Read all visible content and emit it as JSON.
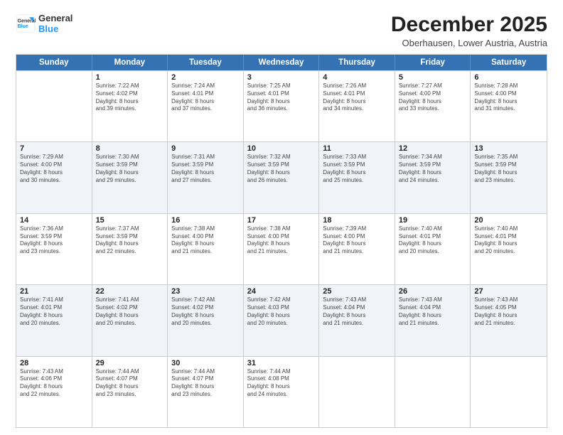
{
  "logo": {
    "line1": "General",
    "line2": "Blue"
  },
  "header": {
    "title": "December 2025",
    "subtitle": "Oberhausen, Lower Austria, Austria"
  },
  "days": [
    "Sunday",
    "Monday",
    "Tuesday",
    "Wednesday",
    "Thursday",
    "Friday",
    "Saturday"
  ],
  "weeks": [
    {
      "shade": "normal",
      "cells": [
        {
          "day": "",
          "lines": []
        },
        {
          "day": "1",
          "lines": [
            "Sunrise: 7:22 AM",
            "Sunset: 4:02 PM",
            "Daylight: 8 hours",
            "and 39 minutes."
          ]
        },
        {
          "day": "2",
          "lines": [
            "Sunrise: 7:24 AM",
            "Sunset: 4:01 PM",
            "Daylight: 8 hours",
            "and 37 minutes."
          ]
        },
        {
          "day": "3",
          "lines": [
            "Sunrise: 7:25 AM",
            "Sunset: 4:01 PM",
            "Daylight: 8 hours",
            "and 36 minutes."
          ]
        },
        {
          "day": "4",
          "lines": [
            "Sunrise: 7:26 AM",
            "Sunset: 4:01 PM",
            "Daylight: 8 hours",
            "and 34 minutes."
          ]
        },
        {
          "day": "5",
          "lines": [
            "Sunrise: 7:27 AM",
            "Sunset: 4:00 PM",
            "Daylight: 8 hours",
            "and 33 minutes."
          ]
        },
        {
          "day": "6",
          "lines": [
            "Sunrise: 7:28 AM",
            "Sunset: 4:00 PM",
            "Daylight: 8 hours",
            "and 31 minutes."
          ]
        }
      ]
    },
    {
      "shade": "alt",
      "cells": [
        {
          "day": "7",
          "lines": [
            "Sunrise: 7:29 AM",
            "Sunset: 4:00 PM",
            "Daylight: 8 hours",
            "and 30 minutes."
          ]
        },
        {
          "day": "8",
          "lines": [
            "Sunrise: 7:30 AM",
            "Sunset: 3:59 PM",
            "Daylight: 8 hours",
            "and 29 minutes."
          ]
        },
        {
          "day": "9",
          "lines": [
            "Sunrise: 7:31 AM",
            "Sunset: 3:59 PM",
            "Daylight: 8 hours",
            "and 27 minutes."
          ]
        },
        {
          "day": "10",
          "lines": [
            "Sunrise: 7:32 AM",
            "Sunset: 3:59 PM",
            "Daylight: 8 hours",
            "and 26 minutes."
          ]
        },
        {
          "day": "11",
          "lines": [
            "Sunrise: 7:33 AM",
            "Sunset: 3:59 PM",
            "Daylight: 8 hours",
            "and 25 minutes."
          ]
        },
        {
          "day": "12",
          "lines": [
            "Sunrise: 7:34 AM",
            "Sunset: 3:59 PM",
            "Daylight: 8 hours",
            "and 24 minutes."
          ]
        },
        {
          "day": "13",
          "lines": [
            "Sunrise: 7:35 AM",
            "Sunset: 3:59 PM",
            "Daylight: 8 hours",
            "and 23 minutes."
          ]
        }
      ]
    },
    {
      "shade": "normal",
      "cells": [
        {
          "day": "14",
          "lines": [
            "Sunrise: 7:36 AM",
            "Sunset: 3:59 PM",
            "Daylight: 8 hours",
            "and 23 minutes."
          ]
        },
        {
          "day": "15",
          "lines": [
            "Sunrise: 7:37 AM",
            "Sunset: 3:59 PM",
            "Daylight: 8 hours",
            "and 22 minutes."
          ]
        },
        {
          "day": "16",
          "lines": [
            "Sunrise: 7:38 AM",
            "Sunset: 4:00 PM",
            "Daylight: 8 hours",
            "and 21 minutes."
          ]
        },
        {
          "day": "17",
          "lines": [
            "Sunrise: 7:38 AM",
            "Sunset: 4:00 PM",
            "Daylight: 8 hours",
            "and 21 minutes."
          ]
        },
        {
          "day": "18",
          "lines": [
            "Sunrise: 7:39 AM",
            "Sunset: 4:00 PM",
            "Daylight: 8 hours",
            "and 21 minutes."
          ]
        },
        {
          "day": "19",
          "lines": [
            "Sunrise: 7:40 AM",
            "Sunset: 4:01 PM",
            "Daylight: 8 hours",
            "and 20 minutes."
          ]
        },
        {
          "day": "20",
          "lines": [
            "Sunrise: 7:40 AM",
            "Sunset: 4:01 PM",
            "Daylight: 8 hours",
            "and 20 minutes."
          ]
        }
      ]
    },
    {
      "shade": "alt",
      "cells": [
        {
          "day": "21",
          "lines": [
            "Sunrise: 7:41 AM",
            "Sunset: 4:01 PM",
            "Daylight: 8 hours",
            "and 20 minutes."
          ]
        },
        {
          "day": "22",
          "lines": [
            "Sunrise: 7:41 AM",
            "Sunset: 4:02 PM",
            "Daylight: 8 hours",
            "and 20 minutes."
          ]
        },
        {
          "day": "23",
          "lines": [
            "Sunrise: 7:42 AM",
            "Sunset: 4:02 PM",
            "Daylight: 8 hours",
            "and 20 minutes."
          ]
        },
        {
          "day": "24",
          "lines": [
            "Sunrise: 7:42 AM",
            "Sunset: 4:03 PM",
            "Daylight: 8 hours",
            "and 20 minutes."
          ]
        },
        {
          "day": "25",
          "lines": [
            "Sunrise: 7:43 AM",
            "Sunset: 4:04 PM",
            "Daylight: 8 hours",
            "and 21 minutes."
          ]
        },
        {
          "day": "26",
          "lines": [
            "Sunrise: 7:43 AM",
            "Sunset: 4:04 PM",
            "Daylight: 8 hours",
            "and 21 minutes."
          ]
        },
        {
          "day": "27",
          "lines": [
            "Sunrise: 7:43 AM",
            "Sunset: 4:05 PM",
            "Daylight: 8 hours",
            "and 21 minutes."
          ]
        }
      ]
    },
    {
      "shade": "normal",
      "cells": [
        {
          "day": "28",
          "lines": [
            "Sunrise: 7:43 AM",
            "Sunset: 4:06 PM",
            "Daylight: 8 hours",
            "and 22 minutes."
          ]
        },
        {
          "day": "29",
          "lines": [
            "Sunrise: 7:44 AM",
            "Sunset: 4:07 PM",
            "Daylight: 8 hours",
            "and 23 minutes."
          ]
        },
        {
          "day": "30",
          "lines": [
            "Sunrise: 7:44 AM",
            "Sunset: 4:07 PM",
            "Daylight: 8 hours",
            "and 23 minutes."
          ]
        },
        {
          "day": "31",
          "lines": [
            "Sunrise: 7:44 AM",
            "Sunset: 4:08 PM",
            "Daylight: 8 hours",
            "and 24 minutes."
          ]
        },
        {
          "day": "",
          "lines": []
        },
        {
          "day": "",
          "lines": []
        },
        {
          "day": "",
          "lines": []
        }
      ]
    }
  ]
}
